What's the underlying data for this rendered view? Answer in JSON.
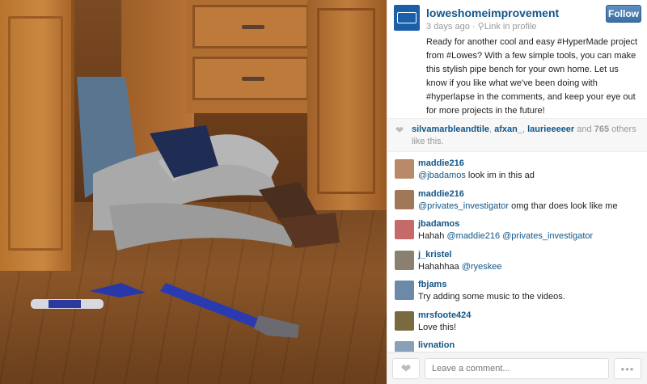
{
  "post": {
    "username": "loweshomeimprovement",
    "time_ago": "3 days ago",
    "location_separator": "·",
    "location": "Link in profile",
    "follow_label": "Follow",
    "caption": "Ready for another cool and easy #HyperMade project from #Lowes? With a few simple tools, you can make this stylish pipe bench for your own home. Let us know if you like what we've been doing with #hyperlapse in the comments, and keep your eye out for more projects in the future!",
    "brand_color": "#1a5fa8",
    "link_color": "#125688"
  },
  "likes": {
    "likers": [
      "silvamarbleandtile",
      "afxan_",
      "laurieeeeer"
    ],
    "and_text": "and",
    "count": "765",
    "suffix": "others like this."
  },
  "comments": [
    {
      "user": "maddie216",
      "mention": "@jbadamos",
      "text": " look im in this ad",
      "avatar_color": "#b98a6a"
    },
    {
      "user": "maddie216",
      "mention": "@privates_investigator",
      "text": " omg thar does look like me",
      "avatar_color": "#a07858"
    },
    {
      "user": "jbadamos",
      "mention": "",
      "text": "Hahah ",
      "mention2": "@maddie216 @privates_investigator",
      "avatar_color": "#c46a6a"
    },
    {
      "user": "j_kristel",
      "mention": "",
      "text": "Hahahhaa ",
      "mention2": "@ryeskee",
      "avatar_color": "#8a8070"
    },
    {
      "user": "fbjams",
      "mention": "",
      "text": "Try adding some music to the videos.",
      "avatar_color": "#6a8aa8"
    },
    {
      "user": "mrsfoote424",
      "mention": "",
      "text": "Love this!",
      "avatar_color": "#7a6a40"
    },
    {
      "user": "livnation",
      "mention": "",
      "text": "",
      "avatar_color": "#8aa0b8"
    }
  ],
  "footer": {
    "comment_placeholder": "Leave a comment...",
    "more_label": "•••"
  }
}
